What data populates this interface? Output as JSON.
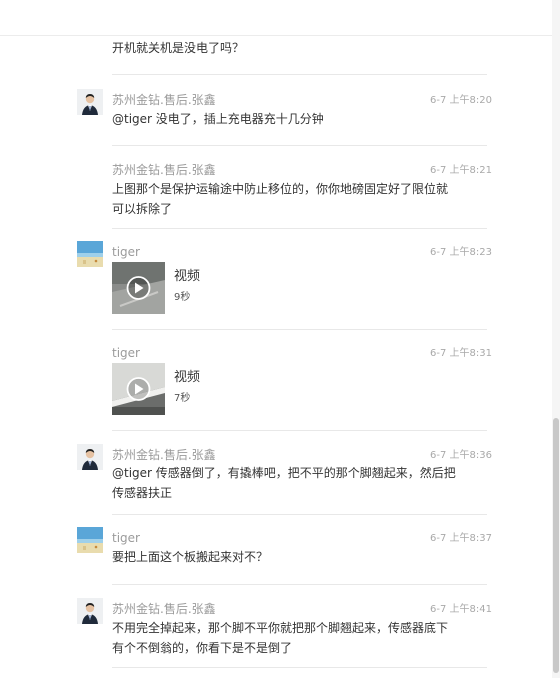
{
  "messages": [
    {
      "sender": "",
      "time": "",
      "text": "开机就关机是没电了吗？"
    },
    {
      "sender": "苏州金钻.售后.张鑫",
      "avatar_icon": "person-in-suit-avatar",
      "time": "6-7 上午8:20",
      "text": "@tiger 没电了，插上充电器充十几分钟"
    },
    {
      "sender": "苏州金钻.售后.张鑫",
      "time": "6-7 上午8:21",
      "text_lines": [
        "上图那个是保护运输途中防止移位的，你你地磅固定好了限位就",
        "可以拆除了"
      ]
    },
    {
      "sender": "tiger",
      "avatar_icon": "beach-scene-avatar",
      "time": "6-7 上午8:23",
      "video": {
        "label": "视频",
        "duration": "9秒",
        "icon": "play-icon"
      }
    },
    {
      "sender": "tiger",
      "time": "6-7 上午8:31",
      "video": {
        "label": "视频",
        "duration": "7秒",
        "icon": "play-icon"
      }
    },
    {
      "sender": "苏州金钻.售后.张鑫",
      "avatar_icon": "person-in-suit-avatar",
      "time": "6-7 上午8:36",
      "text_lines": [
        "@tiger 传感器倒了，有撬棒吧，把不平的那个脚翘起来，然后把",
        "传感器扶正"
      ]
    },
    {
      "sender": "tiger",
      "avatar_icon": "beach-scene-avatar",
      "time": "6-7 上午8:37",
      "text": "要把上面这个板搬起来对不？"
    },
    {
      "sender": "苏州金钻.售后.张鑫",
      "avatar_icon": "person-in-suit-avatar",
      "time": "6-7 上午8:41",
      "text_lines": [
        "不用完全掉起来，那个脚不平你就把那个脚翘起来，传感器底下",
        "有个不倒翁的，你看下是不是倒了"
      ]
    }
  ],
  "colors": {
    "name": "#9b9b9b",
    "time": "#a9a9a9",
    "text": "#333333",
    "divider": "#e8e8e8"
  }
}
